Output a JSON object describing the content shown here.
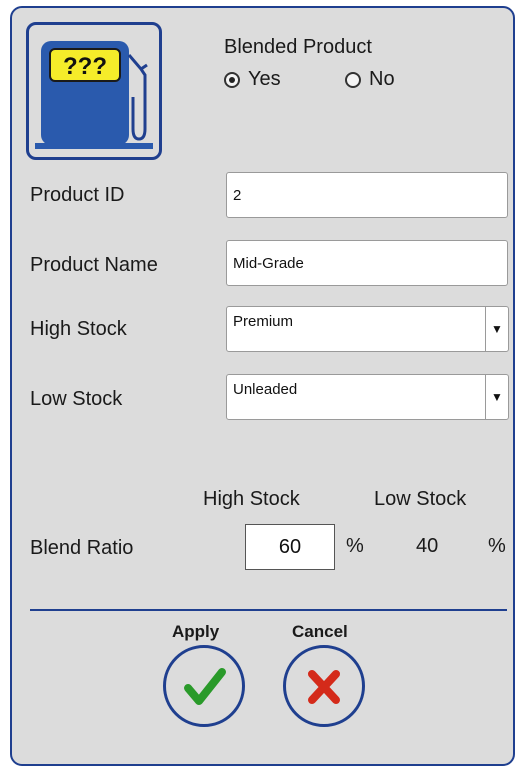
{
  "blended": {
    "title": "Blended Product",
    "yes_label": "Yes",
    "no_label": "No",
    "selected": "Yes"
  },
  "pump_icon": {
    "name": "fuel-pump-icon",
    "sign_text": "???"
  },
  "product_id": {
    "label": "Product ID",
    "value": "2"
  },
  "product_name": {
    "label": "Product Name",
    "value": "Mid-Grade"
  },
  "high_stock": {
    "label": "High Stock",
    "value": "Premium"
  },
  "low_stock": {
    "label": "Low Stock",
    "value": "Unleaded"
  },
  "blend": {
    "high_header": "High Stock",
    "low_header": "Low Stock",
    "label": "Blend Ratio",
    "high_value": "60",
    "high_unit": "%",
    "low_value": "40",
    "low_unit": "%"
  },
  "actions": {
    "apply_label": "Apply",
    "cancel_label": "Cancel"
  },
  "colors": {
    "panel": "#dcdcdc",
    "border": "#1f3f8f",
    "pump_body": "#2a5aad",
    "sign": "#f5ec2a",
    "check": "#2a9a2a",
    "cross": "#d42a1a"
  }
}
